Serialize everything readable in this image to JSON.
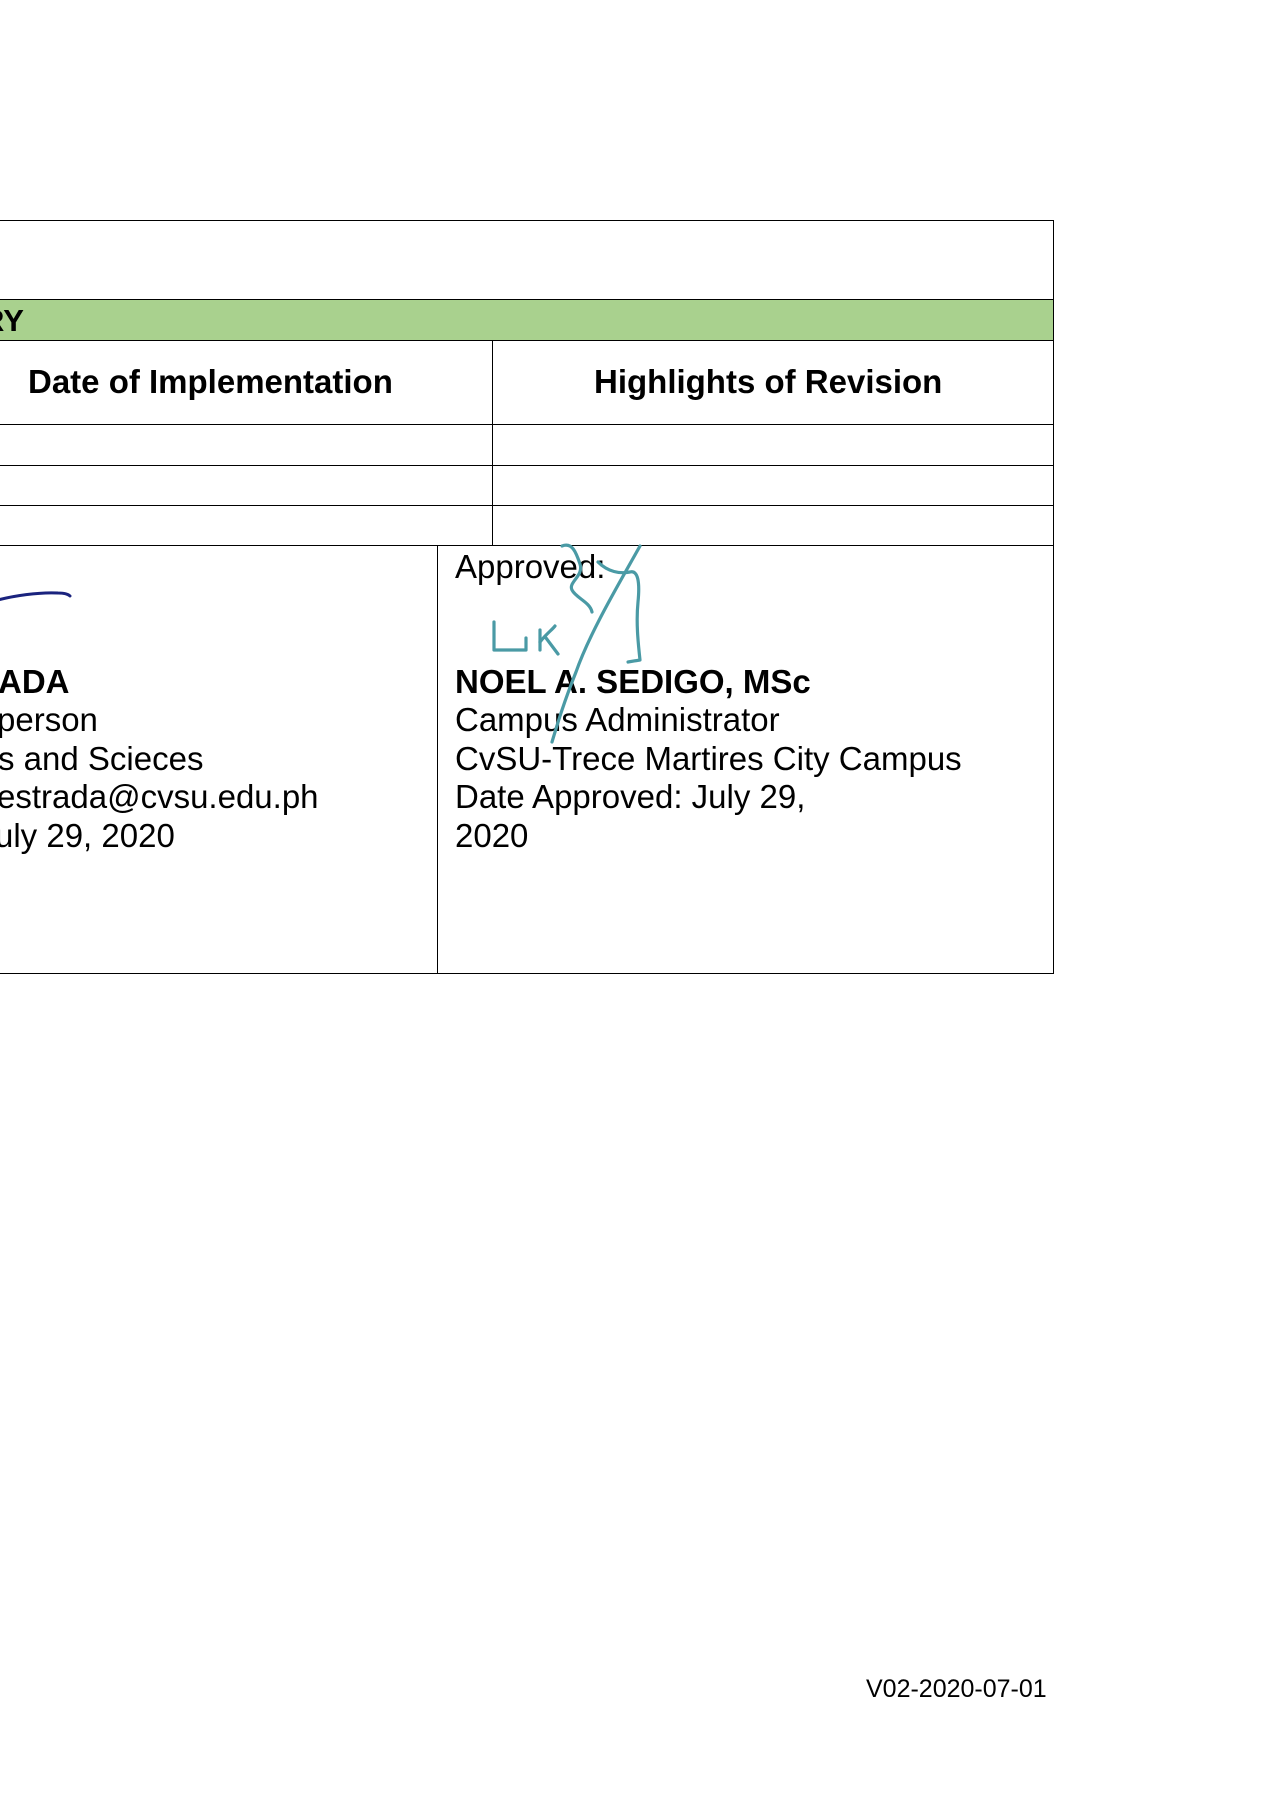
{
  "revision_table": {
    "section_title": "RY",
    "col_date_header": "Date of Implementation",
    "col_highlights_header": "Highlights of Revision"
  },
  "prepared_block": {
    "name_fragment": "ADA",
    "position_fragment": "person",
    "department_fragment": "s and Scieces",
    "email_fragment": "estrada@cvsu.edu.ph",
    "date_fragment": "uly 29, 2020"
  },
  "approved_block": {
    "label": "Approved:",
    "name": "NOEL A. SEDIGO, MSc",
    "position": "Campus Administrator",
    "campus": "CvSU-Trece Martires City Campus",
    "date_line1": "Date Approved: July 29,",
    "date_line2": "2020"
  },
  "signatures": {
    "left_ink_color": "#1a237e",
    "right_ink_color": "#4a9aa5"
  },
  "footer": {
    "version_code": "V02-2020-07-01"
  }
}
